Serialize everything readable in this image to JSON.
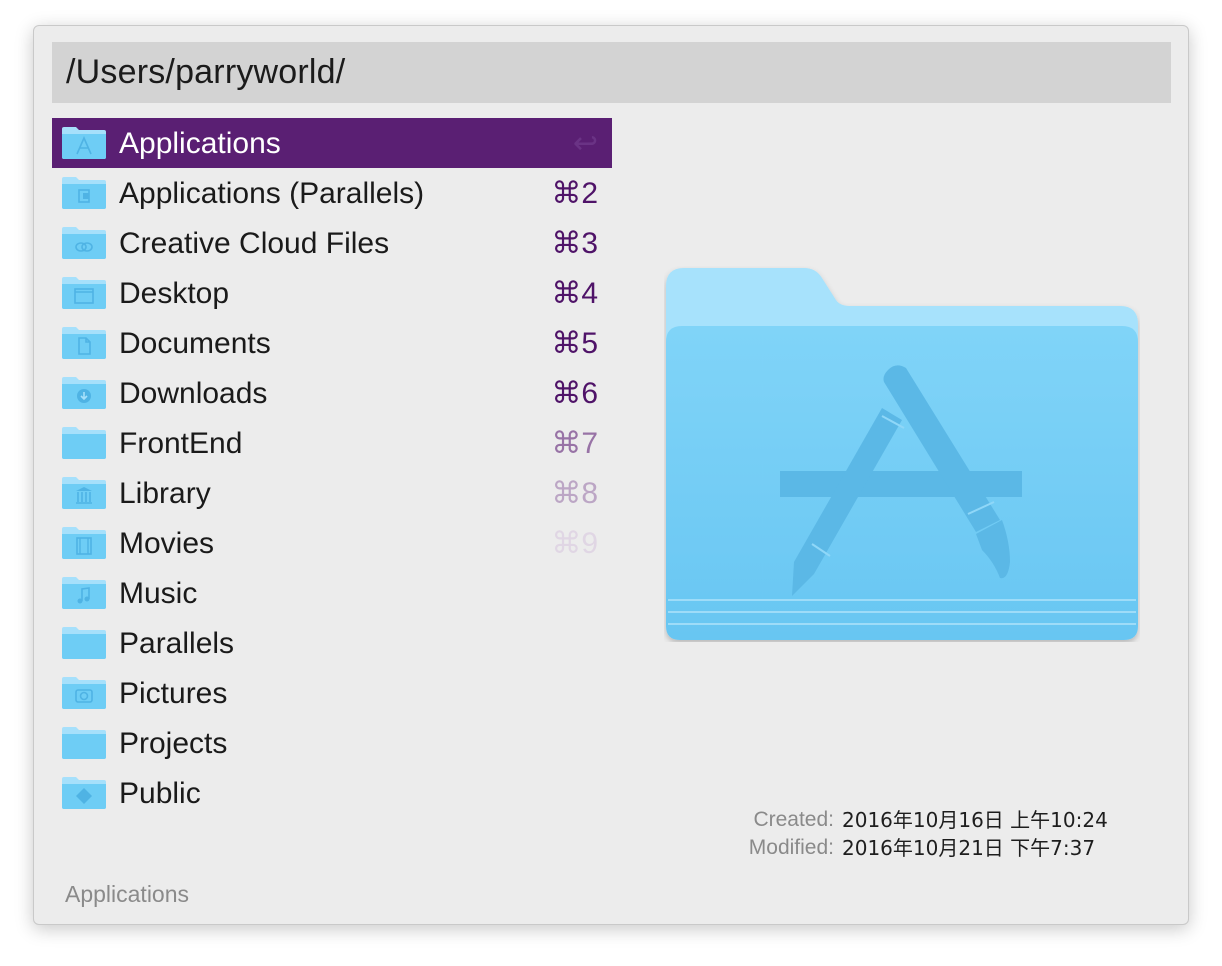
{
  "search": {
    "query": "/Users/parryworld/"
  },
  "results": [
    {
      "label": "Applications",
      "shortcut": "↩",
      "icon": "applications-folder-icon",
      "selected": true
    },
    {
      "label": "Applications (Parallels)",
      "shortcut": "⌘2",
      "icon": "parallels-folder-icon"
    },
    {
      "label": "Creative Cloud Files",
      "shortcut": "⌘3",
      "icon": "creative-cloud-folder-icon"
    },
    {
      "label": "Desktop",
      "shortcut": "⌘4",
      "icon": "desktop-folder-icon"
    },
    {
      "label": "Documents",
      "shortcut": "⌘5",
      "icon": "documents-folder-icon"
    },
    {
      "label": "Downloads",
      "shortcut": "⌘6",
      "icon": "downloads-folder-icon"
    },
    {
      "label": "FrontEnd",
      "shortcut": "⌘7",
      "icon": "folder-icon"
    },
    {
      "label": "Library",
      "shortcut": "⌘8",
      "icon": "library-folder-icon"
    },
    {
      "label": "Movies",
      "shortcut": "⌘9",
      "icon": "movies-folder-icon"
    },
    {
      "label": "Music",
      "shortcut": "",
      "icon": "music-folder-icon"
    },
    {
      "label": "Parallels",
      "shortcut": "",
      "icon": "folder-icon"
    },
    {
      "label": "Pictures",
      "shortcut": "",
      "icon": "pictures-folder-icon"
    },
    {
      "label": "Projects",
      "shortcut": "",
      "icon": "folder-icon"
    },
    {
      "label": "Public",
      "shortcut": "",
      "icon": "public-folder-icon"
    }
  ],
  "preview": {
    "icon": "applications-folder-large-icon",
    "created_label": "Created:",
    "created_value": "2016年10月16日 上午10:24",
    "modified_label": "Modified:",
    "modified_value": "2016年10月21日 下午7:37"
  },
  "status": {
    "text": "Applications"
  },
  "colors": {
    "accent": "#5a1f73",
    "folder_light": "#a6e0fb",
    "folder_dark": "#6ecdf5",
    "background": "#ececec",
    "search_bg": "#d3d3d3"
  }
}
